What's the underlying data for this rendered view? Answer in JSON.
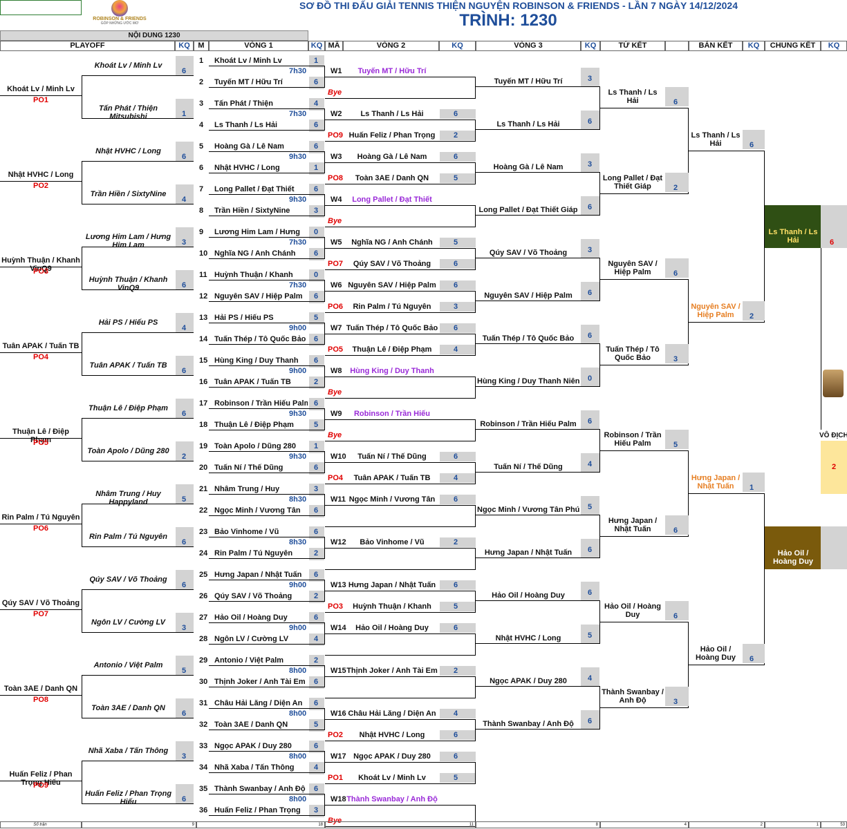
{
  "title_line1": "SƠ ĐỒ THI ĐẤU GIẢI TENNIS THIỆN NGUYỆN ROBINSON & FRIENDS -   LẦN 7 NGÀY 14/12/2024",
  "title_line2": "TRÌNH: 1230",
  "logo_name": "ROBINSON & FRIENDS",
  "logo_slogan": "GÓP NHỮNG ƯỚC MƠ",
  "content_caption": "NỘI DUNG 1230",
  "headers": {
    "playoff": "PLAYOFF",
    "kq": "KQ",
    "m": "M",
    "v1": "VÒNG 1",
    "ma": "MÃ",
    "v2": "VÒNG 2",
    "v3": "VÒNG 3",
    "qf": "TỨ KẾT",
    "sf": "BÁN KẾT",
    "final": "CHUNG KẾT"
  },
  "champion_label": "VÔ ĐỊCH",
  "champion_score": "2",
  "footer": {
    "label": "Số trận",
    "c1": "9",
    "c2": "18",
    "c3": "11",
    "c4": "8",
    "c5": "4",
    "c6": "2",
    "c7": "1",
    "c8": "53"
  },
  "matches": [
    {
      "m": "1",
      "p1": "Khoát Lv / Minh Lv",
      "s1": "1",
      "time": "7h30",
      "m2": "2",
      "p2": "Tuyến MT / Hữu Trí",
      "s2": "6",
      "code": "W1",
      "code_pair": "Tuyến MT / Hữu Trí",
      "opp_code": "Bye",
      "opp_pair": ""
    },
    {
      "m": "3",
      "p1": "Tấn Phát  / Thiện",
      "s1": "4",
      "time": "7h30",
      "m2": "4",
      "p2": "Ls Thanh / Ls Hải",
      "s2": "6",
      "code": "W2",
      "code_pair": "Ls Thanh / Ls Hải",
      "code_score": "6",
      "opp_code": "PO9",
      "opp_pair": "Huấn Feliz / Phan Trọng",
      "opp_score": "2"
    },
    {
      "m": "5",
      "p1": "Hoàng Gà / Lê Nam",
      "s1": "6",
      "time": "9h30",
      "m2": "6",
      "p2": "Nhật HVHC / Long",
      "s2": "1",
      "code": "W3",
      "code_pair": "Hoàng Gà / Lê Nam",
      "code_score": "6",
      "opp_code": "PO8",
      "opp_pair": "Toàn 3AE / Danh QN",
      "opp_score": "5"
    },
    {
      "m": "7",
      "p1": "Long Pallet  / Đạt Thiết",
      "s1": "6",
      "time": "9h30",
      "m2": "8",
      "p2": "Trần Hiền / SixtyNine",
      "s2": "3",
      "code": "W4",
      "code_pair": "Long Pallet  / Đạt Thiết",
      "opp_code": "Bye",
      "opp_pair": ""
    },
    {
      "m": "9",
      "p1": "Lương Him Lam  / Hưng",
      "s1": "0",
      "time": "7h30",
      "m2": "10",
      "p2": "Nghĩa NG / Anh Chánh",
      "s2": "6",
      "code": "W5",
      "code_pair": "Nghĩa NG / Anh Chánh",
      "code_score": "5",
      "opp_code": "PO7",
      "opp_pair": "Qúy SAV / Võ Thoảng",
      "opp_score": "6"
    },
    {
      "m": "11",
      "p1": "Huỳnh Thuận / Khanh",
      "s1": "0",
      "time": "7h30",
      "m2": "12",
      "p2": "Nguyên SAV / Hiệp Palm",
      "s2": "6",
      "code": "W6",
      "code_pair": "Nguyên SAV / Hiệp Palm",
      "code_score": "6",
      "opp_code": "PO6",
      "opp_pair": "Rin Palm / Tú Nguyên",
      "opp_score": "3"
    },
    {
      "m": "13",
      "p1": "Hải PS / Hiếu PS",
      "s1": "5",
      "time": "9h00",
      "m2": "14",
      "p2": "Tuấn Thép / Tô Quốc Bảo",
      "s2": "6",
      "code": "W7",
      "code_pair": "Tuấn Thép / Tô Quốc Bảo",
      "code_score": "6",
      "opp_code": "PO5",
      "opp_pair": "Thuận Lê / Điệp Phạm",
      "opp_score": "4"
    },
    {
      "m": "15",
      "p1": "Hùng King / Duy Thanh",
      "s1": "6",
      "time": "9h00",
      "m2": "16",
      "p2": "Tuân APAK / Tuấn TB",
      "s2": "2",
      "code": "W8",
      "code_pair": "Hùng King / Duy Thanh",
      "opp_code": "Bye",
      "opp_pair": ""
    },
    {
      "m": "17",
      "p1": "Robinson / Trần Hiếu Palm",
      "s1": "6",
      "time": "9h30",
      "m2": "18",
      "p2": "Thuận Lê / Điệp Phạm",
      "s2": "5",
      "code": "W9",
      "code_pair": "Robinson / Trần Hiếu",
      "opp_code": "Bye",
      "opp_pair": ""
    },
    {
      "m": "19",
      "p1": "Toàn Apolo / Dũng 280",
      "s1": "1",
      "time": "9h30",
      "m2": "20",
      "p2": "Tuấn Ní / Thế Dũng",
      "s2": "6",
      "code": "W10",
      "code_pair": "Tuấn Ní / Thế Dũng",
      "code_score": "6",
      "opp_code": "PO4",
      "opp_pair": "Tuân APAK / Tuấn TB",
      "opp_score": "4"
    },
    {
      "m": "21",
      "p1": "Nhâm Trung / Huy",
      "s1": "3",
      "time": "8h30",
      "m2": "22",
      "p2": "Ngọc Minh / Vương Tân",
      "s2": "6",
      "code": "W11",
      "code_pair": "Ngọc Minh / Vương Tân",
      "code_score": "6",
      "opp_code": "",
      "opp_pair": ""
    },
    {
      "m": "23",
      "p1": "Bảo Vinhome / Vũ",
      "s1": "6",
      "time": "8h30",
      "m2": "24",
      "p2": "Rin Palm / Tú Nguyên",
      "s2": "2",
      "code": "W12",
      "code_pair": "Bảo Vinhome / Vũ",
      "code_score": "2",
      "opp_code": "",
      "opp_pair": ""
    },
    {
      "m": "25",
      "p1": "Hưng Japan / Nhật Tuấn",
      "s1": "6",
      "time": "9h00",
      "m2": "26",
      "p2": "Qúy SAV / Võ Thoảng",
      "s2": "2",
      "code": "W13",
      "code_pair": "Hưng Japan / Nhật Tuấn",
      "code_score": "6",
      "opp_code": "PO3",
      "opp_pair": "Huỳnh Thuận / Khanh",
      "opp_score": "5"
    },
    {
      "m": "27",
      "p1": "Hảo Oil  / Hoàng Duy",
      "s1": "6",
      "time": "9h00",
      "m2": "28",
      "p2": "Ngôn LV / Cường LV",
      "s2": "4",
      "code": "W14",
      "code_pair": "Hảo Oil  / Hoàng Duy",
      "code_score": "6",
      "opp_code": "",
      "opp_pair": ""
    },
    {
      "m": "29",
      "p1": "Antonio / Việt Palm",
      "s1": "2",
      "time": "8h00",
      "m2": "30",
      "p2": "Thịnh Joker / Anh Tài Em",
      "s2": "6",
      "code": "W15",
      "code_pair": "Thịnh Joker / Anh Tài Em",
      "code_score": "2",
      "opp_code": "",
      "opp_pair": ""
    },
    {
      "m": "31",
      "p1": "Châu Hải Lăng / Diện An",
      "s1": "6",
      "time": "8h00",
      "m2": "32",
      "p2": "Toàn 3AE / Danh QN",
      "s2": "5",
      "code": "W16",
      "code_pair": "Châu Hải Lăng / Diện An",
      "code_score": "4",
      "opp_code": "PO2",
      "opp_pair": "Nhật HVHC / Long",
      "opp_score": "6"
    },
    {
      "m": "33",
      "p1": "Ngọc APAK / Duy 280",
      "s1": "6",
      "time": "8h00",
      "m2": "34",
      "p2": "Nhã Xaba / Tấn Thông",
      "s2": "4",
      "code": "W17",
      "code_pair": "Ngọc APAK / Duy 280",
      "code_score": "6",
      "opp_code": "PO1",
      "opp_pair": "Khoát Lv / Minh Lv",
      "opp_score": "5"
    },
    {
      "m": "35",
      "p1": "Thành Swanbay / Anh Độ",
      "s1": "6",
      "time": "8h00",
      "m2": "36",
      "p2": "Huấn Feliz / Phan Trọng",
      "s2": "3",
      "code": "W18",
      "code_pair": "Thành Swanbay / Anh Độ",
      "opp_code": "Bye",
      "opp_pair": ""
    }
  ],
  "playoffs": [
    {
      "a": "Khoát Lv / Minh Lv",
      "as": "6",
      "b": "Tấn Phát  / Thiện Mitsubishi",
      "bs": "1",
      "winner": "Khoát Lv / Minh Lv",
      "code": "PO1"
    },
    {
      "a": "Nhật HVHC / Long",
      "as": "6",
      "b": "Trần Hiền / SixtyNine",
      "bs": "4",
      "winner": "Nhật HVHC / Long",
      "code": "PO2"
    },
    {
      "a": "Lương Him Lam  / Hưng Him Lam",
      "as": "3",
      "b": "Huỳnh Thuận / Khanh VinQ9",
      "bs": "6",
      "winner": "Huỳnh Thuận / Khanh VinQ9",
      "code": "PO3"
    },
    {
      "a": "Hải PS / Hiếu PS",
      "as": "4",
      "b": "Tuân APAK / Tuấn TB",
      "bs": "6",
      "winner": "Tuân APAK / Tuấn TB",
      "code": "PO4"
    },
    {
      "a": "Thuận Lê / Điệp Phạm",
      "as": "6",
      "b": "Toàn Apolo / Dũng 280",
      "bs": "2",
      "winner": "Thuận Lê / Điệp Phạm",
      "code": "PO5"
    },
    {
      "a": "Nhâm Trung / Huy Happyland",
      "as": "5",
      "b": "Rin Palm / Tú Nguyên",
      "bs": "6",
      "winner": "Rin Palm / Tú Nguyên",
      "code": "PO6"
    },
    {
      "a": "Qúy SAV / Võ Thoảng",
      "as": "6",
      "b": "Ngôn LV / Cường LV",
      "bs": "3",
      "winner": "Qúy SAV / Võ Thoảng",
      "code": "PO7"
    },
    {
      "a": "Antonio / Việt Palm",
      "as": "5",
      "b": "Toàn 3AE / Danh QN",
      "bs": "6",
      "winner": "Toàn 3AE / Danh QN",
      "code": "PO8"
    },
    {
      "a": "Nhã Xaba / Tấn Thông",
      "as": "3",
      "b": "Huấn Feliz / Phan Trọng Hiếu",
      "bs": "6",
      "winner": "Huấn Feliz / Phan Trọng Hiếu",
      "code": "PO9"
    }
  ],
  "round3": [
    {
      "name": "Tuyến MT / Hữu Trí",
      "score": "3"
    },
    {
      "name": "Ls Thanh / Ls Hải",
      "score": "6"
    },
    {
      "name": "Hoàng Gà / Lê Nam",
      "score": "3"
    },
    {
      "name": "Long Pallet  / Đạt Thiết Giáp",
      "score": "6"
    },
    {
      "name": "Qúy SAV / Võ Thoảng",
      "score": "3"
    },
    {
      "name": "Nguyên SAV / Hiệp Palm",
      "score": "6"
    },
    {
      "name": "Tuấn Thép / Tô Quốc Bảo",
      "score": "6"
    },
    {
      "name": "Hùng King / Duy Thanh Niên",
      "score": "0"
    },
    {
      "name": "Robinson / Trần Hiếu Palm",
      "score": "6"
    },
    {
      "name": "Tuấn Ní / Thế Dũng",
      "score": "4"
    },
    {
      "name": "Ngọc Minh / Vương Tân Phú",
      "score": "5"
    },
    {
      "name": "Hưng Japan / Nhật Tuấn",
      "score": "6"
    },
    {
      "name": "Hảo Oil  / Hoàng Duy",
      "score": "6"
    },
    {
      "name": "Nhật HVHC / Long",
      "score": "5"
    },
    {
      "name": "Ngọc APAK / Duy 280",
      "score": "4"
    },
    {
      "name": "Thành Swanbay / Anh Độ",
      "score": "6"
    }
  ],
  "quarter": [
    {
      "name": "Ls Thanh / Ls Hải",
      "score": "6"
    },
    {
      "name": "Long Pallet  / Đạt Thiết Giáp",
      "score": "2"
    },
    {
      "name": "Nguyên SAV / Hiệp Palm",
      "score": "6"
    },
    {
      "name": "Tuấn Thép / Tô Quốc Bảo",
      "score": "3"
    },
    {
      "name": "Robinson / Trần Hiếu Palm",
      "score": "5"
    },
    {
      "name": "Hưng Japan / Nhật Tuấn",
      "score": "6"
    },
    {
      "name": "Hảo Oil  / Hoàng Duy",
      "score": "6"
    },
    {
      "name": "Thành Swanbay / Anh Độ",
      "score": "3"
    }
  ],
  "semi": [
    {
      "name": "Ls Thanh / Ls Hải",
      "score": "6"
    },
    {
      "name": "Nguyên SAV / Hiệp Palm",
      "score": "2"
    },
    {
      "name": "Hưng Japan / Nhật Tuấn",
      "score": "1"
    },
    {
      "name": "Hảo Oil  / Hoàng Duy",
      "score": "6"
    }
  ],
  "final": [
    {
      "name": "Ls Thanh / Ls Hải",
      "score": "6"
    },
    {
      "name": "Hảo Oil  / Hoàng Duy",
      "score": ""
    }
  ],
  "colors": {
    "title": "#1f4e9a",
    "final_top": "#2f4f14",
    "final_bottom": "#7a5a0c",
    "champion": "#fde69b"
  }
}
